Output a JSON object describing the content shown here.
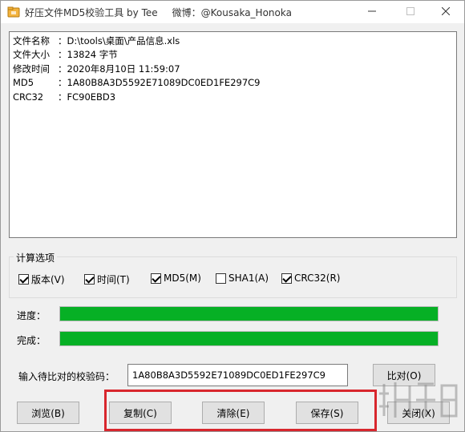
{
  "window": {
    "title": "好压文件MD5校验工具 by Tee",
    "title_weibo": "微博：@Kousaka_Honoka"
  },
  "output": {
    "lines": [
      {
        "label": "文件名称",
        "sep": "：",
        "value": "D:\\tools\\桌面\\产品信息.xls"
      },
      {
        "label": "文件大小",
        "sep": "：",
        "value": "13824 字节"
      },
      {
        "label": "修改时间",
        "sep": "：",
        "value": "2020年8月10日 11:59:07"
      },
      {
        "label": "MD5",
        "sep": "：",
        "value": "1A80B8A3D5592E71089DC0ED1FE297C9"
      },
      {
        "label": "CRC32",
        "sep": "：",
        "value": "FC90EBD3"
      }
    ]
  },
  "options": {
    "legend": "计算选项",
    "items": [
      {
        "label": "版本(V)",
        "checked": true
      },
      {
        "label": "时间(T)",
        "checked": true
      },
      {
        "label": "MD5(M)",
        "checked": true
      },
      {
        "label": "SHA1(A)",
        "checked": false
      },
      {
        "label": "CRC32(R)",
        "checked": true
      }
    ]
  },
  "progress": {
    "label": "进度：",
    "value": 1.0
  },
  "complete": {
    "label": "完成：",
    "value": 1.0
  },
  "compare": {
    "label": "输入待比对的校验码：",
    "value": "1A80B8A3D5592E71089DC0ED1FE297C9",
    "button": "比对(O)"
  },
  "buttons": {
    "browse": "浏览(B)",
    "copy": "复制(C)",
    "clear": "清除(E)",
    "save": "保存(S)",
    "close": "关闭(X)"
  },
  "colors": {
    "progress_fill": "#06b025",
    "highlight": "#d8262d"
  },
  "icons": {
    "app": "haozip-app-icon",
    "minimize": "minimize-icon",
    "maximize": "maximize-icon",
    "close": "close-icon",
    "watermark": "site-logo-watermark"
  }
}
